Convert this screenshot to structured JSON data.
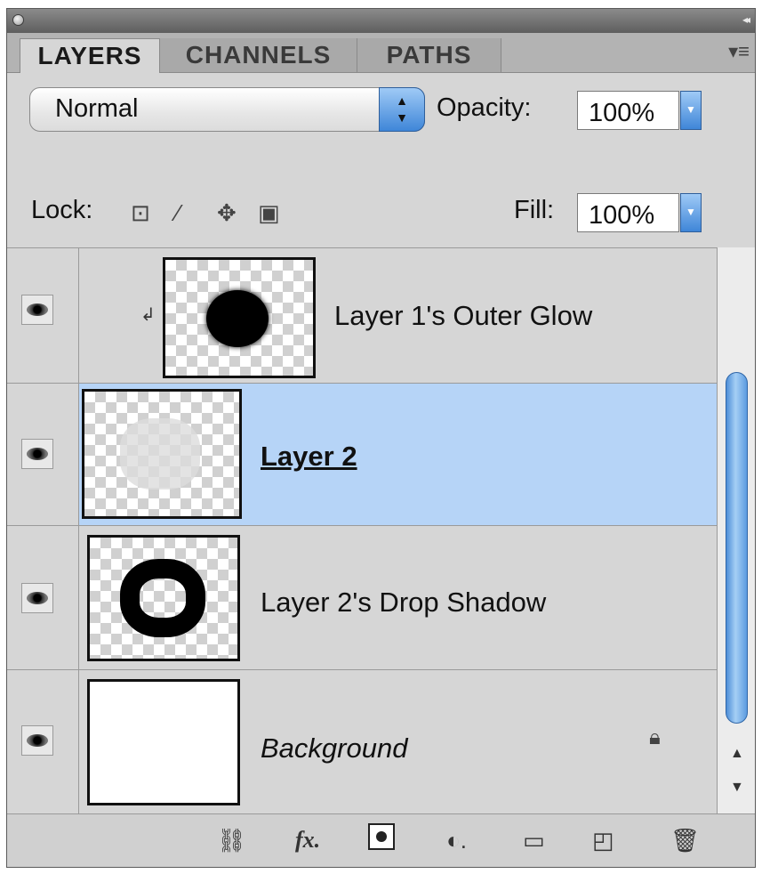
{
  "tabs": [
    {
      "label": "LAYERS"
    },
    {
      "label": "CHANNELS"
    },
    {
      "label": "PATHS"
    }
  ],
  "blend": {
    "mode": "Normal"
  },
  "opacity": {
    "label": "Opacity:",
    "value": "100%"
  },
  "lock": {
    "label": "Lock:"
  },
  "fill": {
    "label": "Fill:",
    "value": "100%"
  },
  "layers": [
    {
      "name": "Layer 1's Outer Glow",
      "visible": true
    },
    {
      "name": "Layer 2",
      "visible": true,
      "selected": true
    },
    {
      "name": "Layer 2's Drop Shadow",
      "visible": true
    },
    {
      "name": "Background",
      "visible": true,
      "locked": true
    }
  ],
  "colors": {
    "selection": "#b6d4f7",
    "panel": "#d6d6d6",
    "accent": "#3f86d8"
  },
  "icons": [
    "eye-icon",
    "lock-icon",
    "link-icon",
    "fx-icon",
    "mask-icon",
    "adjustment-icon",
    "folder-icon",
    "new-layer-icon",
    "trash-icon"
  ]
}
